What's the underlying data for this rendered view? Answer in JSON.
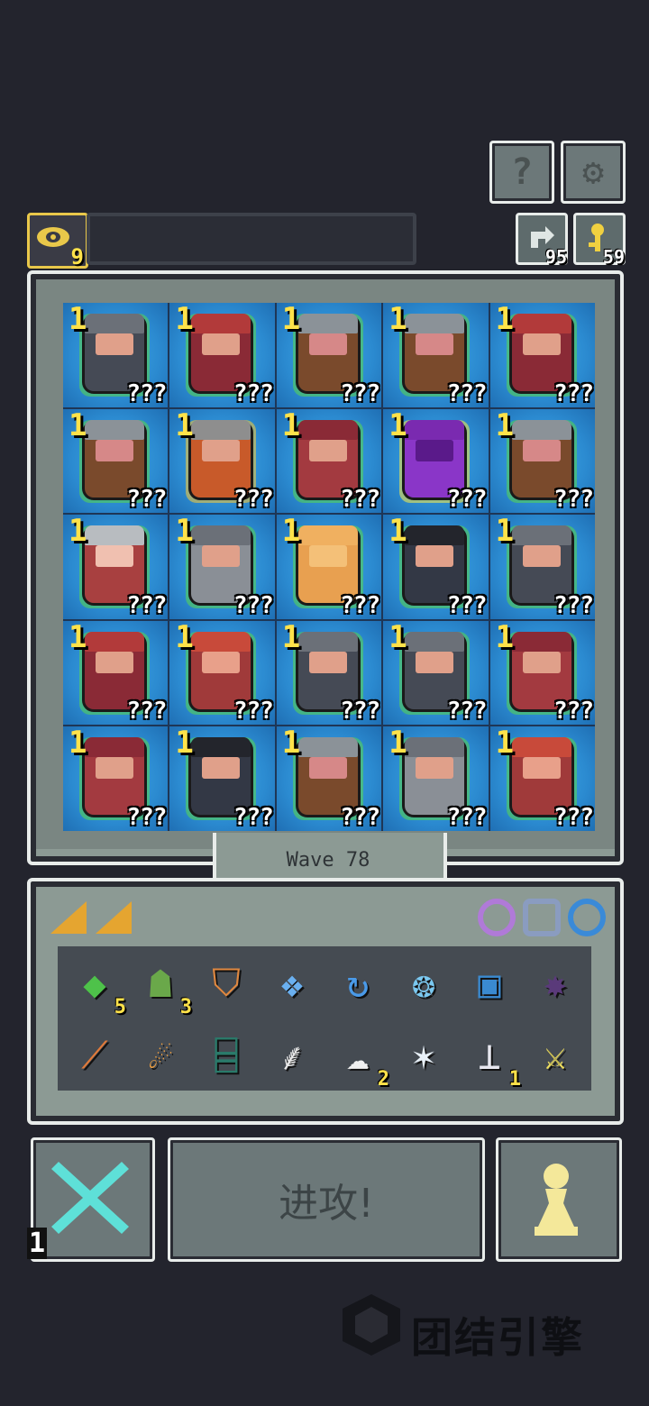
{
  "header": {
    "help_icon": "question-mark-icon",
    "settings_icon": "gear-icon",
    "gold_count": "9",
    "resources": [
      {
        "icon": "recycle-icon",
        "count": "95"
      },
      {
        "icon": "key-icon",
        "count": "59"
      }
    ]
  },
  "board": {
    "cells": [
      {
        "level": "1",
        "label": "???",
        "hat": "#6b7078",
        "skin": "#e0a08a",
        "body": "#454a55",
        "glow": "#5ad84a"
      },
      {
        "level": "1",
        "label": "???",
        "hat": "#b23a3a",
        "skin": "#e0a08a",
        "body": "#8a2a36",
        "glow": "#5ad84a"
      },
      {
        "level": "1",
        "label": "???",
        "hat": "#8b9298",
        "skin": "#d68888",
        "body": "#7a4a2c",
        "glow": "#5ad84a"
      },
      {
        "level": "1",
        "label": "???",
        "hat": "#8b9298",
        "skin": "#d68888",
        "body": "#7a4a2c",
        "glow": "#5ad84a"
      },
      {
        "level": "1",
        "label": "???",
        "hat": "#b23a3a",
        "skin": "#e0a08a",
        "body": "#8a2a36",
        "glow": "#5ad84a"
      },
      {
        "level": "1",
        "label": "???",
        "hat": "#8b9298",
        "skin": "#d68888",
        "body": "#7a4a2c",
        "glow": "#5ad84a"
      },
      {
        "level": "1",
        "label": "???",
        "hat": "#8e8e8e",
        "skin": "#e0a08a",
        "body": "#c85a2a",
        "glow": "#ffcc33"
      },
      {
        "level": "1",
        "label": "???",
        "hat": "#8a2a36",
        "skin": "#e0a08a",
        "body": "#a33a40",
        "glow": "#5ad84a"
      },
      {
        "level": "1",
        "label": "???",
        "hat": "#7a2ab0",
        "skin": "#5a1a8a",
        "body": "#8a36c8",
        "glow": "#ffee44"
      },
      {
        "level": "1",
        "label": "???",
        "hat": "#8b9298",
        "skin": "#d68888",
        "body": "#7a4a2c",
        "glow": "#5ad84a"
      },
      {
        "level": "1",
        "label": "???",
        "hat": "#b8bcc0",
        "skin": "#f0c0b0",
        "body": "#a84040",
        "glow": "#5ad84a"
      },
      {
        "level": "1",
        "label": "???",
        "hat": "#6b7078",
        "skin": "#e0a08a",
        "body": "#8a8f96",
        "glow": "#5ad84a"
      },
      {
        "level": "1",
        "label": "???",
        "hat": "#f0b060",
        "skin": "#f4c078",
        "body": "#e8a050",
        "glow": "#5ad84a"
      },
      {
        "level": "1",
        "label": "???",
        "hat": "#23252c",
        "skin": "#e0a08a",
        "body": "#333845",
        "glow": "#5ad84a"
      },
      {
        "level": "1",
        "label": "???",
        "hat": "#6b7078",
        "skin": "#e0a08a",
        "body": "#454a55",
        "glow": "#5ad84a"
      },
      {
        "level": "1",
        "label": "???",
        "hat": "#b23a3a",
        "skin": "#e0a08a",
        "body": "#8a2a36",
        "glow": "#5ad84a"
      },
      {
        "level": "1",
        "label": "???",
        "hat": "#c84a3a",
        "skin": "#e8a08a",
        "body": "#a03a3a",
        "glow": "#5ad84a"
      },
      {
        "level": "1",
        "label": "???",
        "hat": "#6b7078",
        "skin": "#e0a08a",
        "body": "#454a55",
        "glow": "#5ad84a"
      },
      {
        "level": "1",
        "label": "???",
        "hat": "#6b7078",
        "skin": "#e0a08a",
        "body": "#454a55",
        "glow": "#5ad84a"
      },
      {
        "level": "1",
        "label": "???",
        "hat": "#8a2a36",
        "skin": "#e0a08a",
        "body": "#a33a40",
        "glow": "#5ad84a"
      },
      {
        "level": "1",
        "label": "???",
        "hat": "#8a2a36",
        "skin": "#e0a08a",
        "body": "#a33a40",
        "glow": "#5ad84a"
      },
      {
        "level": "1",
        "label": "???",
        "hat": "#23252c",
        "skin": "#e0a08a",
        "body": "#333845",
        "glow": "#5ad84a"
      },
      {
        "level": "1",
        "label": "???",
        "hat": "#8b9298",
        "skin": "#d68888",
        "body": "#7a4a2c",
        "glow": "#5ad84a"
      },
      {
        "level": "1",
        "label": "???",
        "hat": "#6b7078",
        "skin": "#e0a08a",
        "body": "#8a8f96",
        "glow": "#5ad84a"
      },
      {
        "level": "1",
        "label": "???",
        "hat": "#c84a3a",
        "skin": "#e8a08a",
        "body": "#a03a3a",
        "glow": "#5ad84a"
      }
    ],
    "wave_label": "Wave  78"
  },
  "inventory": {
    "tab_icons": [
      "speed-arrow-icon",
      "speed-arrow-icon"
    ],
    "filter_icons": [
      {
        "name": "purple-ring-icon",
        "color": "#b07ad8"
      },
      {
        "name": "gear-shield-icon",
        "color": "#8a9cc0"
      },
      {
        "name": "blue-ring-icon",
        "color": "#3a8ad8"
      }
    ],
    "items": [
      {
        "icon": "green-gem-icon",
        "glyph": "◆",
        "color": "#4ec24a",
        "count": "5"
      },
      {
        "icon": "archer-icon",
        "glyph": "☗",
        "color": "#6aa84a",
        "count": "3"
      },
      {
        "icon": "orange-shield-icon",
        "glyph": "⛉",
        "color": "#e08840",
        "count": ""
      },
      {
        "icon": "blue-crystal-icon",
        "glyph": "❖",
        "color": "#6ab0f0",
        "count": ""
      },
      {
        "icon": "whirlwind-icon",
        "glyph": "↻",
        "color": "#4a9ae8",
        "count": ""
      },
      {
        "icon": "ice-orb-icon",
        "glyph": "❂",
        "color": "#7ac8f0",
        "count": ""
      },
      {
        "icon": "portal-icon",
        "glyph": "▣",
        "color": "#3a8ad0",
        "count": ""
      },
      {
        "icon": "dark-flame-icon",
        "glyph": "✸",
        "color": "#5a3a7a",
        "count": ""
      },
      {
        "icon": "wooden-stick-icon",
        "glyph": "⟋",
        "color": "#e07a3a",
        "count": ""
      },
      {
        "icon": "fireball-icon",
        "glyph": "☄",
        "color": "#f0a040",
        "count": ""
      },
      {
        "icon": "green-gate-icon",
        "glyph": "⌸",
        "color": "#2a7a6a",
        "count": ""
      },
      {
        "icon": "scythe-icon",
        "glyph": "⸙",
        "color": "#e8e8e8",
        "count": ""
      },
      {
        "icon": "cloud-icon",
        "glyph": "☁",
        "color": "#f0f0f0",
        "count": "2"
      },
      {
        "icon": "ice-spikes-icon",
        "glyph": "✶",
        "color": "#e8f0f8",
        "count": ""
      },
      {
        "icon": "anvil-icon",
        "glyph": "⊥",
        "color": "#e8e8f0",
        "count": "1"
      },
      {
        "icon": "double-axe-icon",
        "glyph": "⚔",
        "color": "#f0e060",
        "count": ""
      }
    ]
  },
  "actions": {
    "cancel_icon": "cross-icon",
    "cancel_count": "1",
    "attack_label": "进攻!",
    "unit_icon": "pawn-icon"
  },
  "watermark": {
    "text": "团结引擎"
  }
}
